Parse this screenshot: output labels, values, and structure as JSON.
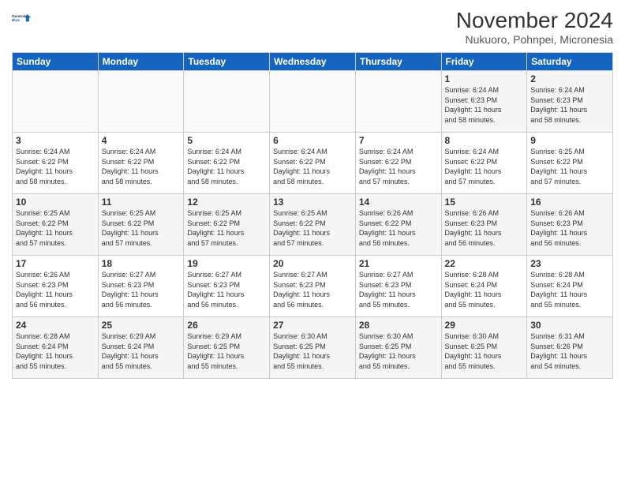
{
  "logo": {
    "line1": "General",
    "line2": "Blue"
  },
  "title": "November 2024",
  "location": "Nukuoro, Pohnpei, Micronesia",
  "days_of_week": [
    "Sunday",
    "Monday",
    "Tuesday",
    "Wednesday",
    "Thursday",
    "Friday",
    "Saturday"
  ],
  "weeks": [
    [
      {
        "day": "",
        "info": ""
      },
      {
        "day": "",
        "info": ""
      },
      {
        "day": "",
        "info": ""
      },
      {
        "day": "",
        "info": ""
      },
      {
        "day": "",
        "info": ""
      },
      {
        "day": "1",
        "info": "Sunrise: 6:24 AM\nSunset: 6:23 PM\nDaylight: 11 hours\nand 58 minutes."
      },
      {
        "day": "2",
        "info": "Sunrise: 6:24 AM\nSunset: 6:23 PM\nDaylight: 11 hours\nand 58 minutes."
      }
    ],
    [
      {
        "day": "3",
        "info": "Sunrise: 6:24 AM\nSunset: 6:22 PM\nDaylight: 11 hours\nand 58 minutes."
      },
      {
        "day": "4",
        "info": "Sunrise: 6:24 AM\nSunset: 6:22 PM\nDaylight: 11 hours\nand 58 minutes."
      },
      {
        "day": "5",
        "info": "Sunrise: 6:24 AM\nSunset: 6:22 PM\nDaylight: 11 hours\nand 58 minutes."
      },
      {
        "day": "6",
        "info": "Sunrise: 6:24 AM\nSunset: 6:22 PM\nDaylight: 11 hours\nand 58 minutes."
      },
      {
        "day": "7",
        "info": "Sunrise: 6:24 AM\nSunset: 6:22 PM\nDaylight: 11 hours\nand 57 minutes."
      },
      {
        "day": "8",
        "info": "Sunrise: 6:24 AM\nSunset: 6:22 PM\nDaylight: 11 hours\nand 57 minutes."
      },
      {
        "day": "9",
        "info": "Sunrise: 6:25 AM\nSunset: 6:22 PM\nDaylight: 11 hours\nand 57 minutes."
      }
    ],
    [
      {
        "day": "10",
        "info": "Sunrise: 6:25 AM\nSunset: 6:22 PM\nDaylight: 11 hours\nand 57 minutes."
      },
      {
        "day": "11",
        "info": "Sunrise: 6:25 AM\nSunset: 6:22 PM\nDaylight: 11 hours\nand 57 minutes."
      },
      {
        "day": "12",
        "info": "Sunrise: 6:25 AM\nSunset: 6:22 PM\nDaylight: 11 hours\nand 57 minutes."
      },
      {
        "day": "13",
        "info": "Sunrise: 6:25 AM\nSunset: 6:22 PM\nDaylight: 11 hours\nand 57 minutes."
      },
      {
        "day": "14",
        "info": "Sunrise: 6:26 AM\nSunset: 6:22 PM\nDaylight: 11 hours\nand 56 minutes."
      },
      {
        "day": "15",
        "info": "Sunrise: 6:26 AM\nSunset: 6:23 PM\nDaylight: 11 hours\nand 56 minutes."
      },
      {
        "day": "16",
        "info": "Sunrise: 6:26 AM\nSunset: 6:23 PM\nDaylight: 11 hours\nand 56 minutes."
      }
    ],
    [
      {
        "day": "17",
        "info": "Sunrise: 6:26 AM\nSunset: 6:23 PM\nDaylight: 11 hours\nand 56 minutes."
      },
      {
        "day": "18",
        "info": "Sunrise: 6:27 AM\nSunset: 6:23 PM\nDaylight: 11 hours\nand 56 minutes."
      },
      {
        "day": "19",
        "info": "Sunrise: 6:27 AM\nSunset: 6:23 PM\nDaylight: 11 hours\nand 56 minutes."
      },
      {
        "day": "20",
        "info": "Sunrise: 6:27 AM\nSunset: 6:23 PM\nDaylight: 11 hours\nand 56 minutes."
      },
      {
        "day": "21",
        "info": "Sunrise: 6:27 AM\nSunset: 6:23 PM\nDaylight: 11 hours\nand 55 minutes."
      },
      {
        "day": "22",
        "info": "Sunrise: 6:28 AM\nSunset: 6:24 PM\nDaylight: 11 hours\nand 55 minutes."
      },
      {
        "day": "23",
        "info": "Sunrise: 6:28 AM\nSunset: 6:24 PM\nDaylight: 11 hours\nand 55 minutes."
      }
    ],
    [
      {
        "day": "24",
        "info": "Sunrise: 6:28 AM\nSunset: 6:24 PM\nDaylight: 11 hours\nand 55 minutes."
      },
      {
        "day": "25",
        "info": "Sunrise: 6:29 AM\nSunset: 6:24 PM\nDaylight: 11 hours\nand 55 minutes."
      },
      {
        "day": "26",
        "info": "Sunrise: 6:29 AM\nSunset: 6:25 PM\nDaylight: 11 hours\nand 55 minutes."
      },
      {
        "day": "27",
        "info": "Sunrise: 6:30 AM\nSunset: 6:25 PM\nDaylight: 11 hours\nand 55 minutes."
      },
      {
        "day": "28",
        "info": "Sunrise: 6:30 AM\nSunset: 6:25 PM\nDaylight: 11 hours\nand 55 minutes."
      },
      {
        "day": "29",
        "info": "Sunrise: 6:30 AM\nSunset: 6:25 PM\nDaylight: 11 hours\nand 55 minutes."
      },
      {
        "day": "30",
        "info": "Sunrise: 6:31 AM\nSunset: 6:26 PM\nDaylight: 11 hours\nand 54 minutes."
      }
    ]
  ]
}
